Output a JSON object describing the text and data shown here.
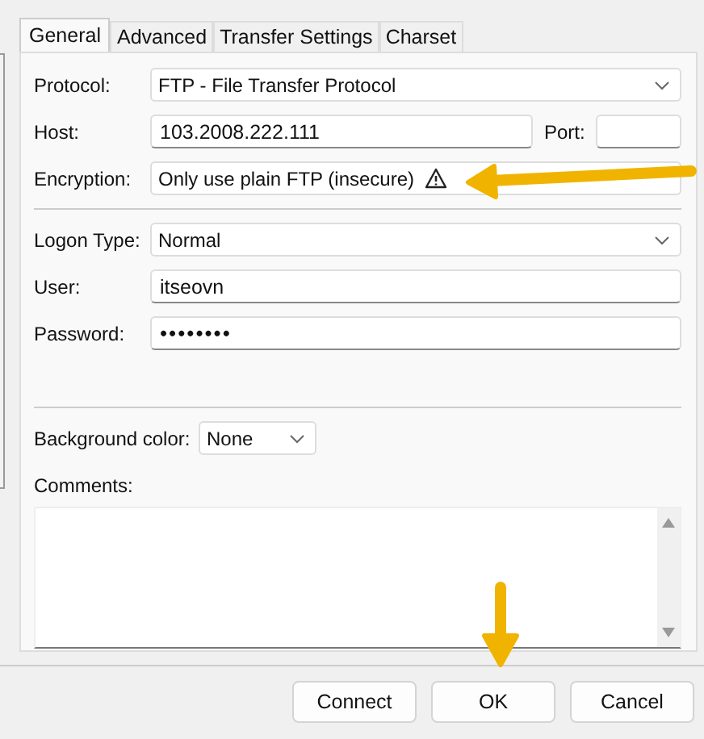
{
  "tabs": [
    {
      "label": "General",
      "selected": true
    },
    {
      "label": "Advanced",
      "selected": false
    },
    {
      "label": "Transfer Settings",
      "selected": false
    },
    {
      "label": "Charset",
      "selected": false
    }
  ],
  "protocol": {
    "label": "Protocol:",
    "value": "FTP - File Transfer Protocol"
  },
  "host": {
    "label": "Host:",
    "value": "103.2008.222.111"
  },
  "port": {
    "label": "Port:"
  },
  "encryption": {
    "label": "Encryption:",
    "value": "Only use plain FTP (insecure)",
    "warning": true
  },
  "logon_type": {
    "label": "Logon Type:",
    "value": "Normal"
  },
  "user": {
    "label": "User:",
    "value": "itseovn"
  },
  "password": {
    "label": "Password:",
    "value": "••••••••"
  },
  "background_color": {
    "label": "Background color:",
    "value": "None"
  },
  "comments": {
    "label": "Comments:"
  },
  "buttons": [
    "Connect",
    "OK",
    "Cancel"
  ]
}
